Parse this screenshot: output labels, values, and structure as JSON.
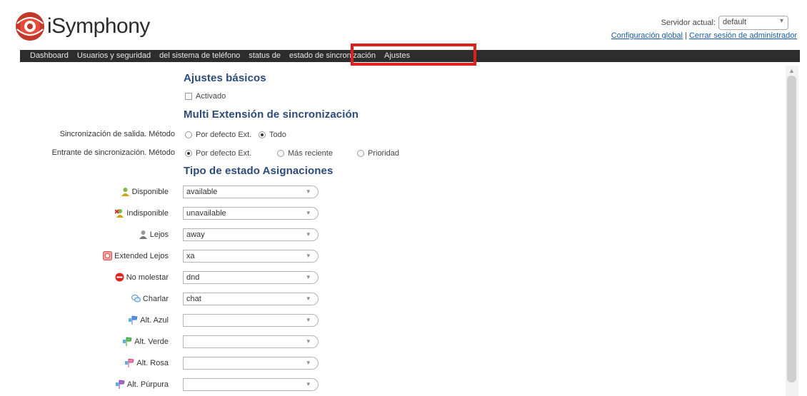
{
  "header": {
    "app_name": "iSymphony",
    "server_label": "Servidor actual:",
    "server_value": "default",
    "links": {
      "global_config": "Configuración global",
      "separator": "|",
      "logout": "Cerrar sesión de administrador"
    }
  },
  "nav": {
    "tabs": [
      "Dashboard",
      "Usuarios y seguridad",
      "del sistema de teléfono",
      "status de",
      "estado de sincronización",
      "Ajustes"
    ],
    "active_highlight_color": "#e0201c"
  },
  "basic": {
    "title": "Ajustes básicos",
    "enabled_label": "Activado"
  },
  "multi": {
    "title": "Multi Extensión de sincronización",
    "outgoing": {
      "label": "Sincronización de salida. Método",
      "options": [
        "Por defecto Ext.",
        "Todo"
      ],
      "selected": "Todo"
    },
    "incoming": {
      "label": "Entrante de sincronización. Método",
      "options": [
        "Por defecto Ext.",
        "Más reciente",
        "Prioridad"
      ],
      "selected": "Por defecto Ext."
    }
  },
  "status_map": {
    "title": "Tipo de estado Asignaciones",
    "rows": [
      {
        "label": "Disponible",
        "value": "available",
        "icon": "user-available-icon"
      },
      {
        "label": "Indisponible",
        "value": "unavailable",
        "icon": "user-unavailable-icon"
      },
      {
        "label": "Lejos",
        "value": "away",
        "icon": "user-away-icon"
      },
      {
        "label": "Extended Lejos",
        "value": "xa",
        "icon": "extended-away-icon"
      },
      {
        "label": "No molestar",
        "value": "dnd",
        "icon": "do-not-disturb-icon"
      },
      {
        "label": "Charlar",
        "value": "chat",
        "icon": "chat-icon"
      },
      {
        "label": "Alt. Azul",
        "value": "",
        "icon": "blue-flag-icon"
      },
      {
        "label": "Alt. Verde",
        "value": "",
        "icon": "green-flag-icon"
      },
      {
        "label": "Alt. Rosa",
        "value": "",
        "icon": "pink-flag-icon"
      },
      {
        "label": "Alt. Púrpura",
        "value": "",
        "icon": "purple-flag-icon"
      }
    ]
  }
}
